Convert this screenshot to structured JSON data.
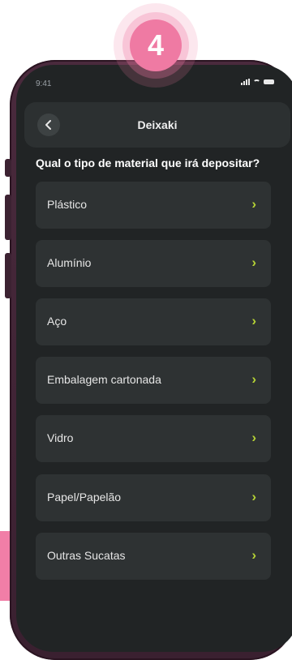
{
  "step_badge": "4",
  "status_bar": {
    "time": "9:41"
  },
  "header": {
    "title": "Deixaki",
    "back_icon": "chevron-left-icon"
  },
  "question": "Qual o tipo de material que irá depositar?",
  "options": [
    {
      "label": "Plástico"
    },
    {
      "label": "Alumínio"
    },
    {
      "label": "Aço"
    },
    {
      "label": "Embalagem cartonada"
    },
    {
      "label": "Vidro"
    },
    {
      "label": "Papel/Papelão"
    },
    {
      "label": "Outras Sucatas"
    }
  ],
  "colors": {
    "accent_pink": "#ef7aa3",
    "chevron_green": "#b5d335",
    "screen_bg": "#212425",
    "card_bg": "#2e3233"
  }
}
